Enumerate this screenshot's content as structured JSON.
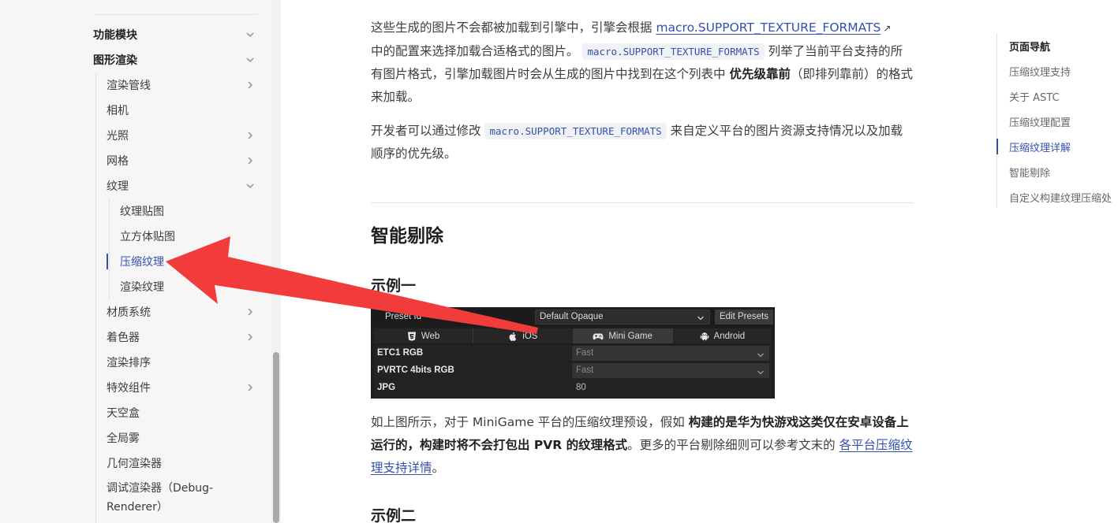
{
  "sidebar": {
    "items": [
      {
        "label": "功能模块",
        "caret": "chevron-down-icon"
      },
      {
        "label": "图形渲染",
        "caret": "chevron-down-icon"
      },
      {
        "label": "渲染管线",
        "caret": "chevron-right-icon"
      },
      {
        "label": "相机"
      },
      {
        "label": "光照",
        "caret": "chevron-right-icon"
      },
      {
        "label": "网格",
        "caret": "chevron-right-icon"
      },
      {
        "label": "纹理",
        "caret": "chevron-down-icon"
      },
      {
        "label": "纹理贴图"
      },
      {
        "label": "立方体贴图"
      },
      {
        "label": "压缩纹理",
        "active": true
      },
      {
        "label": "渲染纹理"
      },
      {
        "label": "材质系统",
        "caret": "chevron-right-icon"
      },
      {
        "label": "着色器",
        "caret": "chevron-right-icon"
      },
      {
        "label": "渲染排序"
      },
      {
        "label": "特效组件",
        "caret": "chevron-right-icon"
      },
      {
        "label": "天空盒"
      },
      {
        "label": "全局雾"
      },
      {
        "label": "几何渲染器"
      },
      {
        "label": "调试渲染器（Debug-Renderer）"
      }
    ]
  },
  "content": {
    "p1": {
      "a": "这些生成的图片不会都被加载到引擎中，引擎会根据 ",
      "link": "macro.SUPPORT_TEXTURE_FORMATS",
      "b": "中的配置来选择加载合适格式的图片。",
      "code": "macro.SUPPORT_TEXTURE_FORMATS",
      "c": " 列举了当前平台支持的所有图片格式，引擎加载图片时会从生成的图片中找到在这个列表中 ",
      "bold": "优先级靠前",
      "d": "（即排列靠前）的格式来加载。"
    },
    "p2": {
      "a": "开发者可以通过修改 ",
      "code": "macro.SUPPORT_TEXTURE_FORMATS",
      "b": " 来自定义平台的图片资源支持情况以及加载顺序的优先级。"
    },
    "h2": "智能剔除",
    "h3_1": "示例一",
    "p3": {
      "a": "如上图所示，对于 MiniGame 平台的压缩纹理预设，假如 ",
      "bold": "构建的是华为快游戏这类仅在安卓设备上运行的，构建时将不会打包出 PVR 的纹理格式",
      "b": "。更多的平台剔除细则可以参考文末的 ",
      "link": "各平台压缩纹理支持详情",
      "c": "。"
    },
    "h3_2": "示例二"
  },
  "panel": {
    "preset_label": "Preset Id",
    "preset_value": "Default Opaque",
    "edit_button": "Edit Presets",
    "tabs": [
      {
        "label": "Web",
        "icon": "html5-icon"
      },
      {
        "label": "iOS",
        "icon": "apple-icon"
      },
      {
        "label": "Mini Game",
        "icon": "gamepad-icon",
        "active": true
      },
      {
        "label": "Android",
        "icon": "android-icon"
      }
    ],
    "rows": [
      {
        "label": "ETC1 RGB",
        "value": "Fast"
      },
      {
        "label": "PVRTC 4bits RGB",
        "value": "Fast"
      },
      {
        "label": "JPG",
        "value": "80"
      }
    ]
  },
  "toc": {
    "title": "页面导航",
    "items": [
      {
        "label": "压缩纹理支持"
      },
      {
        "label": "关于 ASTC"
      },
      {
        "label": "压缩纹理配置"
      },
      {
        "label": "压缩纹理详解",
        "active": true
      },
      {
        "label": "智能剔除"
      },
      {
        "label": "自定义构建纹理压缩处"
      }
    ]
  },
  "colors": {
    "accent": "#3451b2",
    "annotation_arrow": "#f23c3c",
    "sidebar_bg": "#f6f6f7"
  }
}
